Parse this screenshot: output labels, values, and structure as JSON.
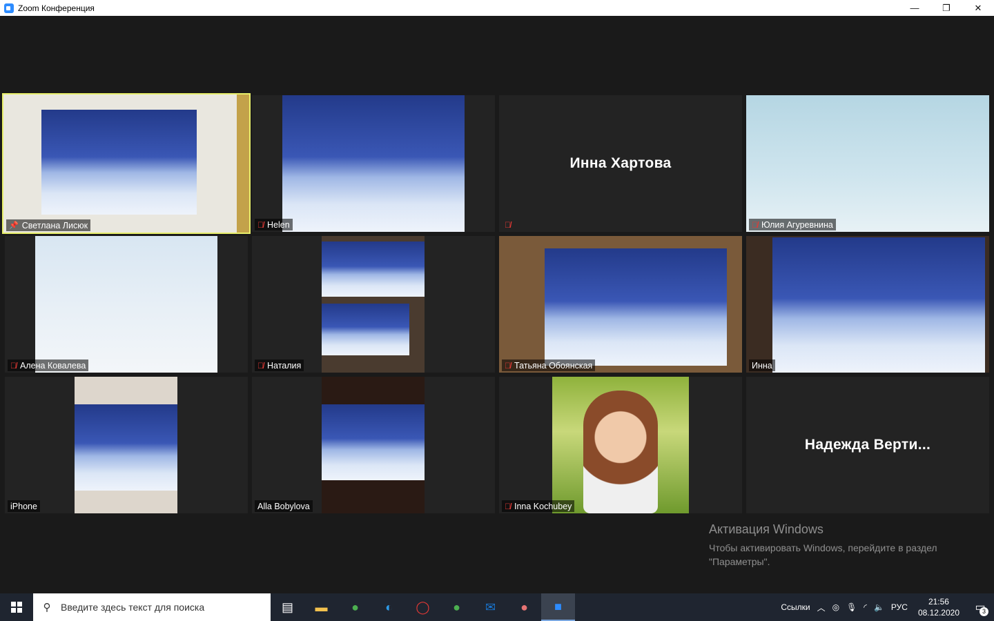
{
  "window": {
    "title": "Zoom Конференция",
    "minimize": "—",
    "restore": "❐",
    "close": "✕"
  },
  "participants": [
    {
      "name": "Светлана Лисюк",
      "muted": false,
      "pinned": true,
      "active": true
    },
    {
      "name": "Helen",
      "muted": true
    },
    {
      "name": "Инна Хартова",
      "muted": true,
      "video_off": true
    },
    {
      "name": "Юлия Агуревнина",
      "muted": true
    },
    {
      "name": "Алена Ковалева",
      "muted": true
    },
    {
      "name": "Наталия",
      "muted": true
    },
    {
      "name": "Татьяна Обоянская",
      "muted": true
    },
    {
      "name": "Инна",
      "muted": false
    },
    {
      "name": "iPhone",
      "muted": false
    },
    {
      "name": "Alla Bobylova",
      "muted": false
    },
    {
      "name": "Inna Kochubey",
      "muted": true
    },
    {
      "name": "Надежда  Верти...",
      "video_off": true
    }
  ],
  "activation": {
    "title": "Активация Windows",
    "line1": "Чтобы активировать Windows, перейдите в раздел",
    "line2": "\"Параметры\"."
  },
  "taskbar": {
    "search_placeholder": "Введите здесь текст для поиска",
    "links_label": "Ссылки",
    "lang": "РУС",
    "time": "21:56",
    "date": "08.12.2020",
    "notifications": "3"
  },
  "colors": {
    "active_border": "#e8ef6a",
    "mute_red": "#e53935",
    "zoom_blue": "#2d8cff"
  }
}
